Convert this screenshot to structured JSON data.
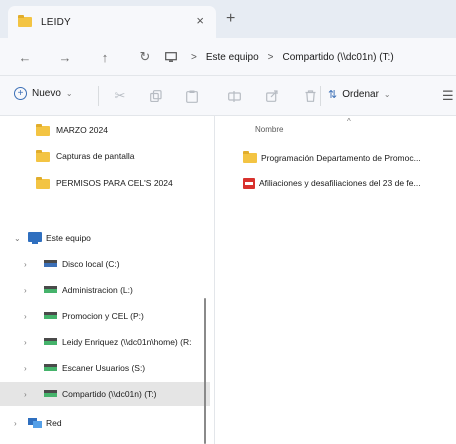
{
  "tab": {
    "title": "LEIDY",
    "close": "×",
    "new": "+"
  },
  "nav": {
    "back": "←",
    "forward": "→",
    "up": "↑",
    "refresh": "↻",
    "breadcrumb": [
      "Este equipo",
      "Compartido (\\\\dc01n) (T:)"
    ],
    "separator": ">"
  },
  "command_bar": {
    "new_label": "Nuevo",
    "sort_label": "Ordenar",
    "icons": [
      "cut-icon",
      "copy-icon",
      "paste-icon",
      "rename-icon",
      "share-icon",
      "delete-icon"
    ]
  },
  "nav_pane": {
    "quick_access": [
      "MARZO 2024",
      "Capturas de pantalla",
      "PERMISOS PARA CEL'S 2024"
    ],
    "this_pc": "Este equipo",
    "drives": [
      "Disco local (C:)",
      "Administracion (L:)",
      "Promocion y CEL (P:)",
      "Leidy Enriquez (\\\\dc01n\\home) (R:",
      "Escaner Usuarios (S:)",
      "Compartido (\\\\dc01n) (T:)"
    ],
    "network": "Red"
  },
  "content": {
    "column_name": "Nombre",
    "files": [
      {
        "name": "Programación Departamento de Promoc...",
        "type": "folder"
      },
      {
        "name": "Afiliaciones y desafiliaciones del 23 de fe...",
        "type": "pdf"
      }
    ]
  },
  "colors": {
    "accent": "#3b6fb6",
    "folder": "#f3c443",
    "pdf": "#d8322e",
    "network_drive": "#45b36b"
  }
}
